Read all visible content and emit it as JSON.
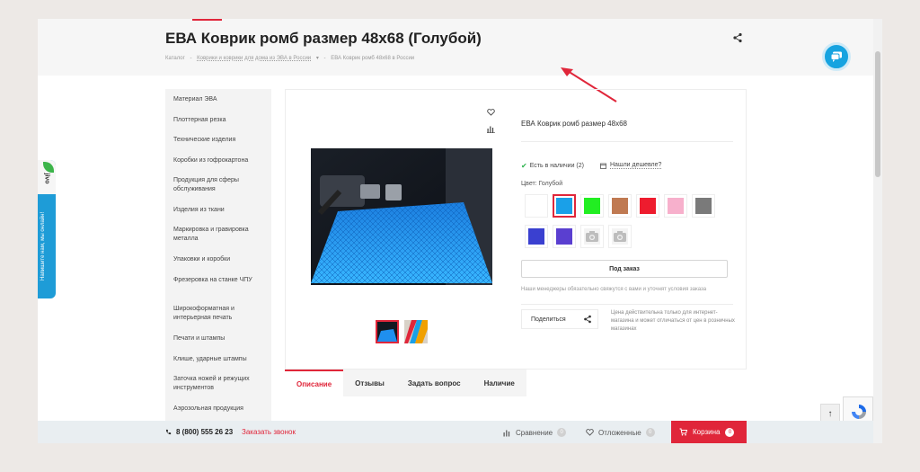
{
  "header": {
    "title": "ЕВА Коврик ромб размер 48х68 (Голубой)",
    "breadcrumb": [
      "Каталог",
      "-",
      "Коврики и коврики для дома из ЭВА в России",
      "▾",
      "-",
      "ЕВА Коврик ромб 48х68 в России"
    ]
  },
  "sidebar": {
    "items": [
      "Материал ЭВА",
      "Плоттерная резка",
      "Технические изделия",
      "Коробки из гофрокартона",
      "Продукция для сферы обслуживания",
      "Изделия из ткани",
      "Маркировка и гравировка металла",
      "Упаковки и коробки",
      "Фрезеровка на станке ЧПУ",
      "Широкоформатная и интерьерная печать",
      "Печати и штампы",
      "Клише, ударные штампы",
      "Заточка ножей и режущих инструментов",
      "Аэрозольная продукция"
    ]
  },
  "product": {
    "name": "ЕВА Коврик ромб размер 48х68",
    "stock": "Есть в наличии (2)",
    "cheaper": "Нашли дешевле?",
    "color_label": "Цвет: Голубой",
    "swatches": [
      {
        "color": "#ffffff"
      },
      {
        "color": "#1aa0e8",
        "selected": true
      },
      {
        "color": "#22ee22"
      },
      {
        "color": "#c07a52"
      },
      {
        "color": "#ee1c2e"
      },
      {
        "color": "#f7b0cc"
      },
      {
        "color": "#7a7a7a"
      },
      {
        "color": "#3a40d0"
      },
      {
        "color": "#5a3fd0"
      },
      {
        "color": "photo-placeholder"
      },
      {
        "color": "photo-placeholder"
      }
    ],
    "order_button": "Под заказ",
    "note": "Наши менеджеры обязательно свяжутся с вами и уточнят условия заказа",
    "share": "Поделиться",
    "price_note": "Цена действительна только для интернет-магазина и может отличаться от цен в розничных магазинах"
  },
  "tabs": [
    "Описание",
    "Отзывы",
    "Задать вопрос",
    "Наличие"
  ],
  "bottom_bar": {
    "phone": "8 (800) 555 26 23",
    "callback": "Заказать звонок",
    "compare": "Сравнение",
    "compare_count": "0",
    "deferred": "Отложенные",
    "deferred_count": "0",
    "cart": "Корзина",
    "cart_count": "0"
  },
  "jivo": {
    "logo": "jivo",
    "text": "Напишите нам, мы онлайн!"
  },
  "colors": {
    "accent": "#e0263a",
    "chat": "#16a3e0"
  }
}
